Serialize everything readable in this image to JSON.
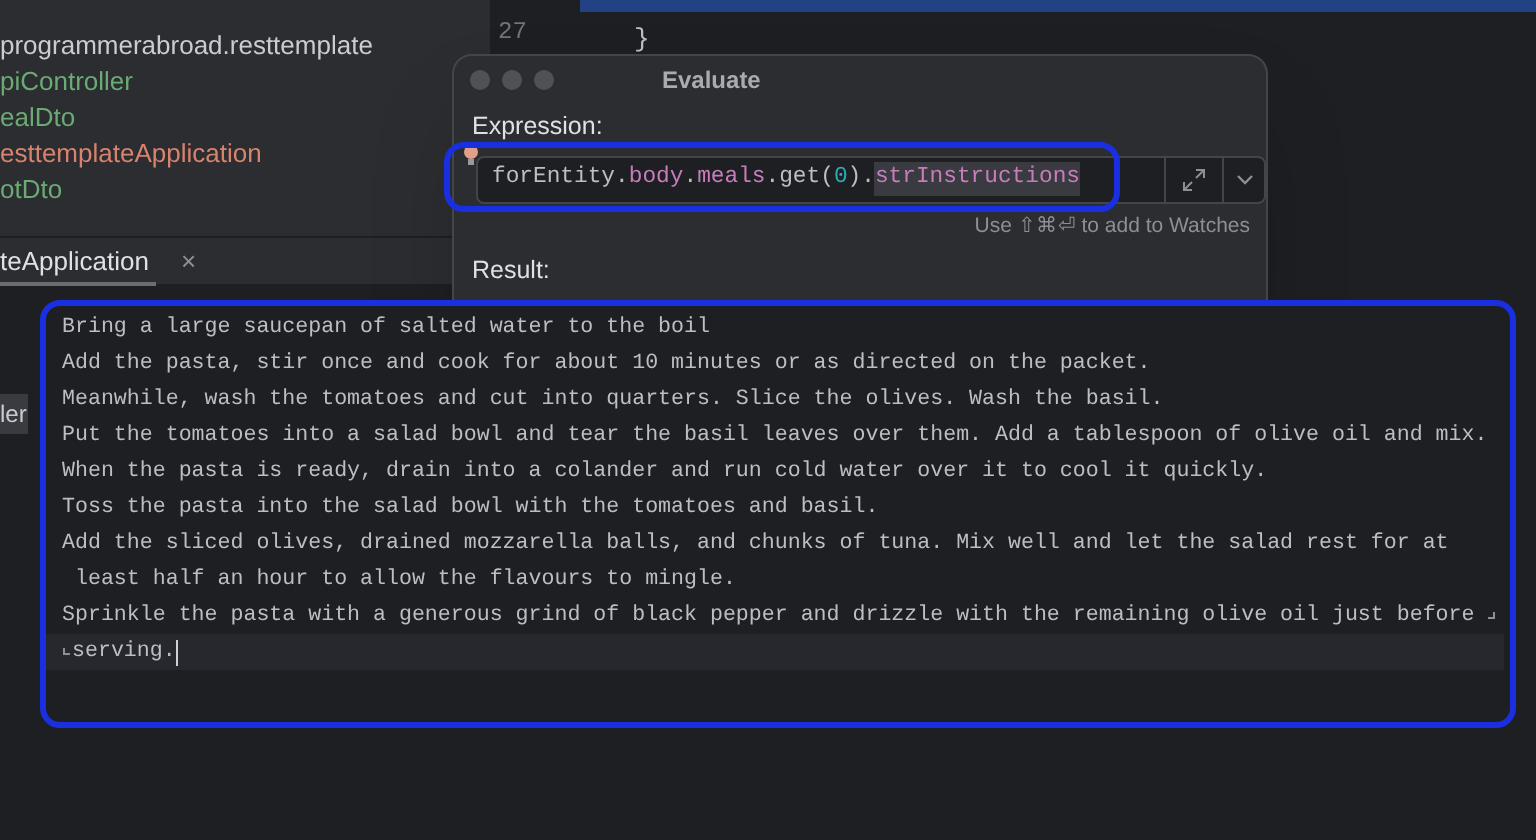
{
  "project_tree": [
    {
      "label": "programmerabroad.resttemplate",
      "color": "#c9ccd2"
    },
    {
      "label": "piController",
      "color": "#6aab73"
    },
    {
      "label": "ealDto",
      "color": "#6aab73"
    },
    {
      "label": "esttemplateApplication",
      "color": "#d9826e"
    },
    {
      "label": "otDto",
      "color": "#6aab73"
    }
  ],
  "run_tab": {
    "label": "teApplication",
    "close": "×"
  },
  "side_label": "ler",
  "editor": {
    "line_number": "27",
    "code": "}"
  },
  "evaluate_dialog": {
    "title": "Evaluate",
    "expression_label": "Expression:",
    "expression": [
      {
        "text": "forEntity",
        "kind": "plain"
      },
      {
        "text": ".",
        "kind": "plain"
      },
      {
        "text": "body",
        "kind": "field"
      },
      {
        "text": ".",
        "kind": "plain"
      },
      {
        "text": "meals",
        "kind": "field"
      },
      {
        "text": ".get(",
        "kind": "plain"
      },
      {
        "text": "0",
        "kind": "number"
      },
      {
        "text": ").",
        "kind": "plain"
      },
      {
        "text": "strInstructions",
        "kind": "highlight"
      }
    ],
    "hint": "Use ⇧⌘⏎ to add to Watches",
    "result_label": "Result:"
  },
  "text_popup": {
    "lines": [
      {
        "text": "Bring a large saucepan of salted water to the boil",
        "wrap_marker": false,
        "current": false
      },
      {
        "text": "Add the pasta, stir once and cook for about 10 minutes or as directed on the packet.",
        "wrap_marker": false,
        "current": false
      },
      {
        "text": "Meanwhile, wash the tomatoes and cut into quarters. Slice the olives. Wash the basil.",
        "wrap_marker": false,
        "current": false
      },
      {
        "text": "Put the tomatoes into a salad bowl and tear the basil leaves over them. Add a tablespoon of olive oil and mix.",
        "wrap_marker": false,
        "current": false
      },
      {
        "text": "When the pasta is ready, drain into a colander and run cold water over it to cool it quickly.",
        "wrap_marker": false,
        "current": false
      },
      {
        "text": "Toss the pasta into the salad bowl with the tomatoes and basil.",
        "wrap_marker": false,
        "current": false
      },
      {
        "text": "Add the sliced olives, drained mozzarella balls, and chunks of tuna. Mix well and let the salad rest for at",
        "wrap_marker": false,
        "current": false
      },
      {
        "text": " least half an hour to allow the flavours to mingle.",
        "wrap_marker": false,
        "current": false
      },
      {
        "text": "Sprinkle the pasta with a generous grind of black pepper and drizzle with the remaining olive oil just before",
        "wrap_marker": true,
        "current": false
      },
      {
        "text": "serving.",
        "wrap_marker": false,
        "current": true
      }
    ]
  }
}
